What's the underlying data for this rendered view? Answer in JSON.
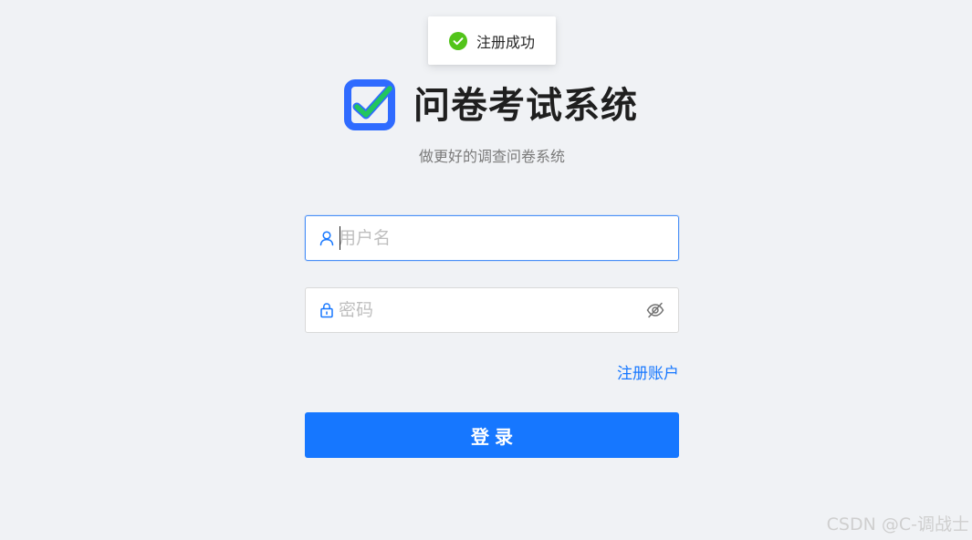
{
  "toast": {
    "icon": "check-circle-icon",
    "message": "注册成功",
    "color": "#52c41a"
  },
  "header": {
    "logo": "checkbox-logo-icon",
    "title": "问卷考试系统",
    "subtitle": "做更好的调查问卷系统"
  },
  "form": {
    "username": {
      "icon": "user-icon",
      "placeholder": "用户名",
      "value": ""
    },
    "password": {
      "icon": "lock-icon",
      "placeholder": "密码",
      "value": "",
      "toggle_icon": "eye-invisible-icon"
    },
    "register_link": "注册账户",
    "login_button": "登录"
  },
  "watermark": "CSDN @C-调战士",
  "colors": {
    "primary": "#1677ff",
    "success": "#52c41a",
    "background": "#f0f2f5"
  }
}
